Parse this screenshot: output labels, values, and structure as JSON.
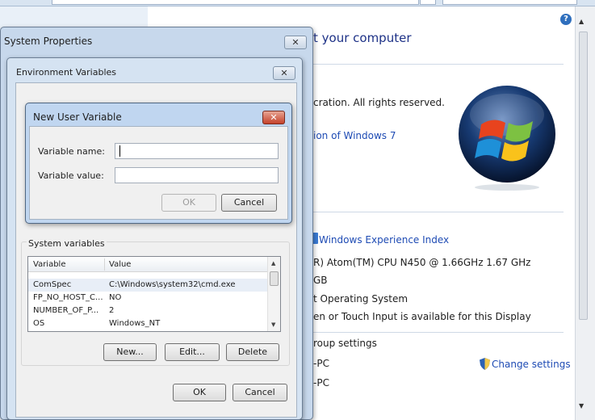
{
  "background": {
    "heading": "t your computer",
    "copyright": "cration.  All rights reserved.",
    "edition_link": "ion of Windows 7",
    "wei_link": "Windows Experience Index",
    "processor": "R) Atom(TM) CPU N450   @ 1.66GHz  1.67 GHz",
    "memory": "GB",
    "system_type": "t Operating System",
    "pen_touch": "en or Touch Input is available for this Display",
    "group_settings": "roup settings",
    "computer_name": "-PC",
    "full_name": "-PC",
    "change_settings": "Change settings",
    "help": "?"
  },
  "system_properties": {
    "title": "System Properties",
    "close": "✕"
  },
  "environment_variables": {
    "title": "Environment Variables",
    "close": "✕",
    "system_group_label": "System variables",
    "columns": {
      "variable": "Variable",
      "value": "Value"
    },
    "rows": [
      {
        "variable": "ComSpec",
        "value": "C:\\Windows\\system32\\cmd.exe"
      },
      {
        "variable": "FP_NO_HOST_C...",
        "value": "NO"
      },
      {
        "variable": "NUMBER_OF_P...",
        "value": "2"
      },
      {
        "variable": "OS",
        "value": "Windows_NT"
      }
    ],
    "buttons": {
      "new": "New...",
      "edit": "Edit...",
      "delete": "Delete",
      "ok": "OK",
      "cancel": "Cancel"
    }
  },
  "new_user_variable": {
    "title": "New User Variable",
    "close": "✕",
    "name_label": "Variable name:",
    "name_value": "",
    "value_label": "Variable value:",
    "value_value": "",
    "ok": "OK",
    "cancel": "Cancel"
  },
  "colors": {
    "title_blue": "#1e3287",
    "link_blue": "#1e4bb4",
    "close_red": "#c4412a"
  }
}
